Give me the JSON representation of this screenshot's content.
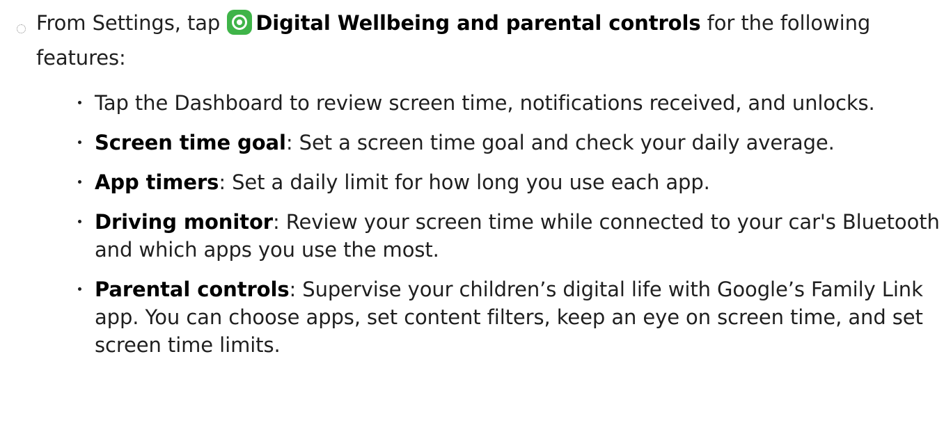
{
  "intro": {
    "prefix": "From Settings, tap",
    "app_name": "Digital Wellbeing and parental controls",
    "suffix": "for the following features:",
    "app_icon": "digital-wellbeing-icon",
    "app_icon_color": "#3fb449"
  },
  "features": [
    {
      "term": "",
      "sep": "",
      "text": "Tap the Dashboard to review screen time, notifications received, and unlocks."
    },
    {
      "term": "Screen time goal",
      "sep": ": ",
      "text": "Set a screen time goal and check your daily average."
    },
    {
      "term": "App timers",
      "sep": ": ",
      "text": "Set a daily limit for how long you use each app."
    },
    {
      "term": "Driving monitor",
      "sep": ": ",
      "text": "Review your screen time while connected to your car's Bluetooth and which apps you use the most."
    },
    {
      "term": "Parental controls",
      "sep": ": ",
      "text": "Supervise your children’s digital life with Google’s Family Link app. You can choose apps, set content filters, keep an eye on screen time, and set screen time limits."
    }
  ]
}
